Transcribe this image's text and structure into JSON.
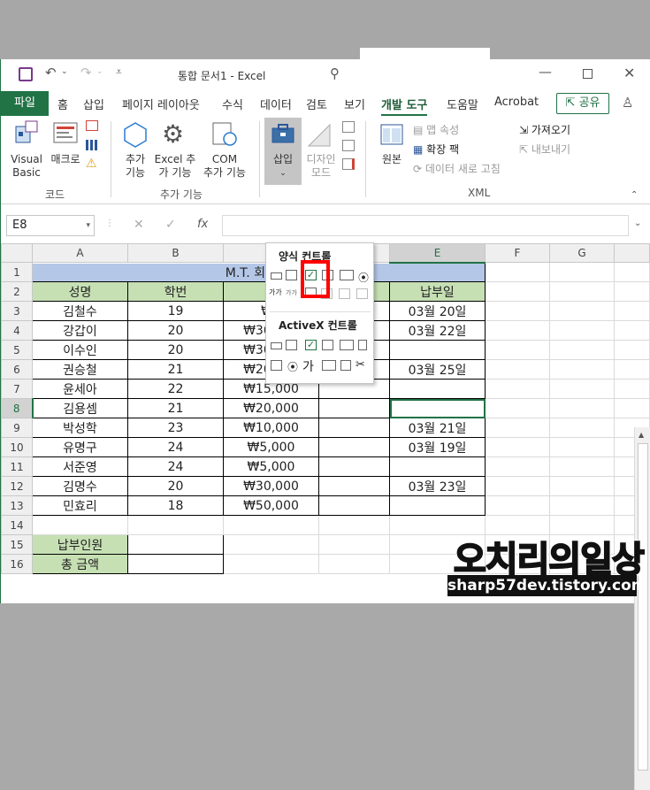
{
  "window": {
    "title": "통합 문서1  -  Excel"
  },
  "tabs": {
    "file": "파일",
    "items": [
      "홈",
      "삽입",
      "페이지 레이아웃",
      "수식",
      "데이터",
      "검토",
      "보기",
      "개발 도구",
      "도움말",
      "Acrobat"
    ],
    "active": "개발 도구",
    "share": "공유"
  },
  "ribbon": {
    "visual_basic": "Visual Basic",
    "vb_line1": "Visual",
    "vb_line2": "Basic",
    "macro": "매크로",
    "group_code": "코드",
    "addins": "추가 기능",
    "addins_l1": "추가",
    "addins_l2": "기능",
    "excel_addins_l1": "Excel 추",
    "excel_addins_l2": "가 기능",
    "com_l1": "COM",
    "com_l2": "추가 기능",
    "group_addins": "추가 기능",
    "insert": "삽입",
    "design_l1": "디자인",
    "design_l2": "모드",
    "source": "원본",
    "map_properties": "맵 속성",
    "expansion_packs": "확장 팩",
    "refresh_data": "데이터 새로 고침",
    "import": "가져오기",
    "export": "내보내기",
    "group_xml": "XML"
  },
  "formula_bar": {
    "name_box": "E8",
    "fx": "fx",
    "value": ""
  },
  "dropdown": {
    "form_controls": "양식 컨트롤",
    "activex_controls": "ActiveX 컨트롤"
  },
  "sheet": {
    "columns": [
      "A",
      "B",
      "C",
      "D",
      "E",
      "F",
      "G"
    ],
    "rows": [
      "1",
      "2",
      "3",
      "4",
      "5",
      "6",
      "7",
      "8",
      "9",
      "10",
      "11",
      "12",
      "13",
      "14",
      "15",
      "16"
    ],
    "title": "M.T. 회비 납",
    "headers": [
      "성명",
      "학번",
      "회",
      "",
      "납부일"
    ],
    "data": [
      [
        "김철수",
        "19",
        "₩4",
        "",
        "03월 20일"
      ],
      [
        "강갑이",
        "20",
        "₩30,000",
        "",
        "03월 22일"
      ],
      [
        "이수인",
        "20",
        "₩30,000",
        "",
        ""
      ],
      [
        "권승철",
        "21",
        "₩20,000",
        "",
        "03월 25일"
      ],
      [
        "윤세아",
        "22",
        "₩15,000",
        "",
        ""
      ],
      [
        "김용셈",
        "21",
        "₩20,000",
        "",
        ""
      ],
      [
        "박성학",
        "23",
        "₩10,000",
        "",
        "03월 21일"
      ],
      [
        "유명구",
        "24",
        "₩5,000",
        "",
        "03월 19일"
      ],
      [
        "서준영",
        "24",
        "₩5,000",
        "",
        ""
      ],
      [
        "김명수",
        "20",
        "₩30,000",
        "",
        "03월 23일"
      ],
      [
        "민효리",
        "18",
        "₩50,000",
        "",
        ""
      ]
    ],
    "summary": [
      "납부인원",
      "총 금액"
    ]
  },
  "watermark": {
    "title": "오치리의일상",
    "url": "sharp57dev.tistory.com"
  },
  "colors": {
    "accent": "#217346",
    "title_fill": "#b4c7e7",
    "header_fill": "#c6e0b4",
    "highlight": "#ff0000"
  }
}
